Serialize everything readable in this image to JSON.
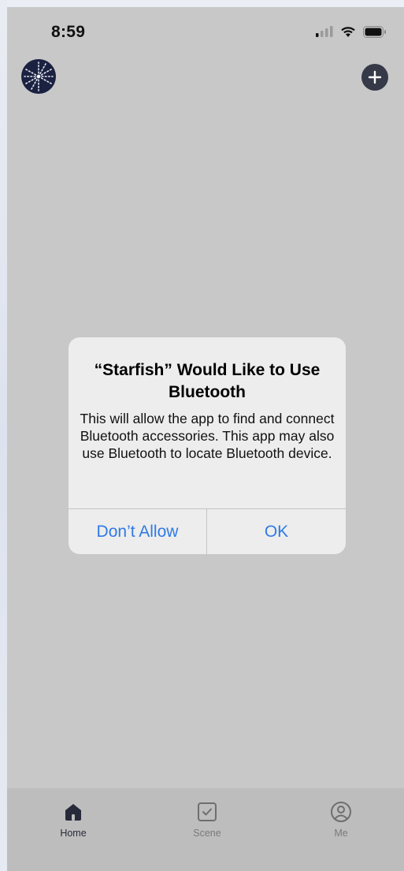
{
  "status_bar": {
    "time": "8:59",
    "icons": [
      "cellular-signal-icon",
      "wifi-icon",
      "battery-icon"
    ]
  },
  "header": {
    "avatar_icon": "starfish-logo-icon",
    "add_icon": "plus-icon"
  },
  "alert": {
    "title": "“Starfish” Would Like to Use Bluetooth",
    "message": "This will allow the app to find and connect Bluetooth accessories. This app may also use Bluetooth to locate Bluetooth device.",
    "deny_label": "Don’t Allow",
    "ok_label": "OK"
  },
  "tab_bar": {
    "items": [
      {
        "label": "Home",
        "icon": "home-icon",
        "active": true
      },
      {
        "label": "Scene",
        "icon": "checkbox-icon",
        "active": false
      },
      {
        "label": "Me",
        "icon": "user-circle-icon",
        "active": false
      }
    ]
  },
  "colors": {
    "overlay": "#c8c8c8",
    "alert_background": "#ededed",
    "alert_button": "#2f7ae5",
    "tab_active": "#262a3a",
    "tab_inactive": "#7a7a7a",
    "avatar_background": "#1b2140"
  }
}
